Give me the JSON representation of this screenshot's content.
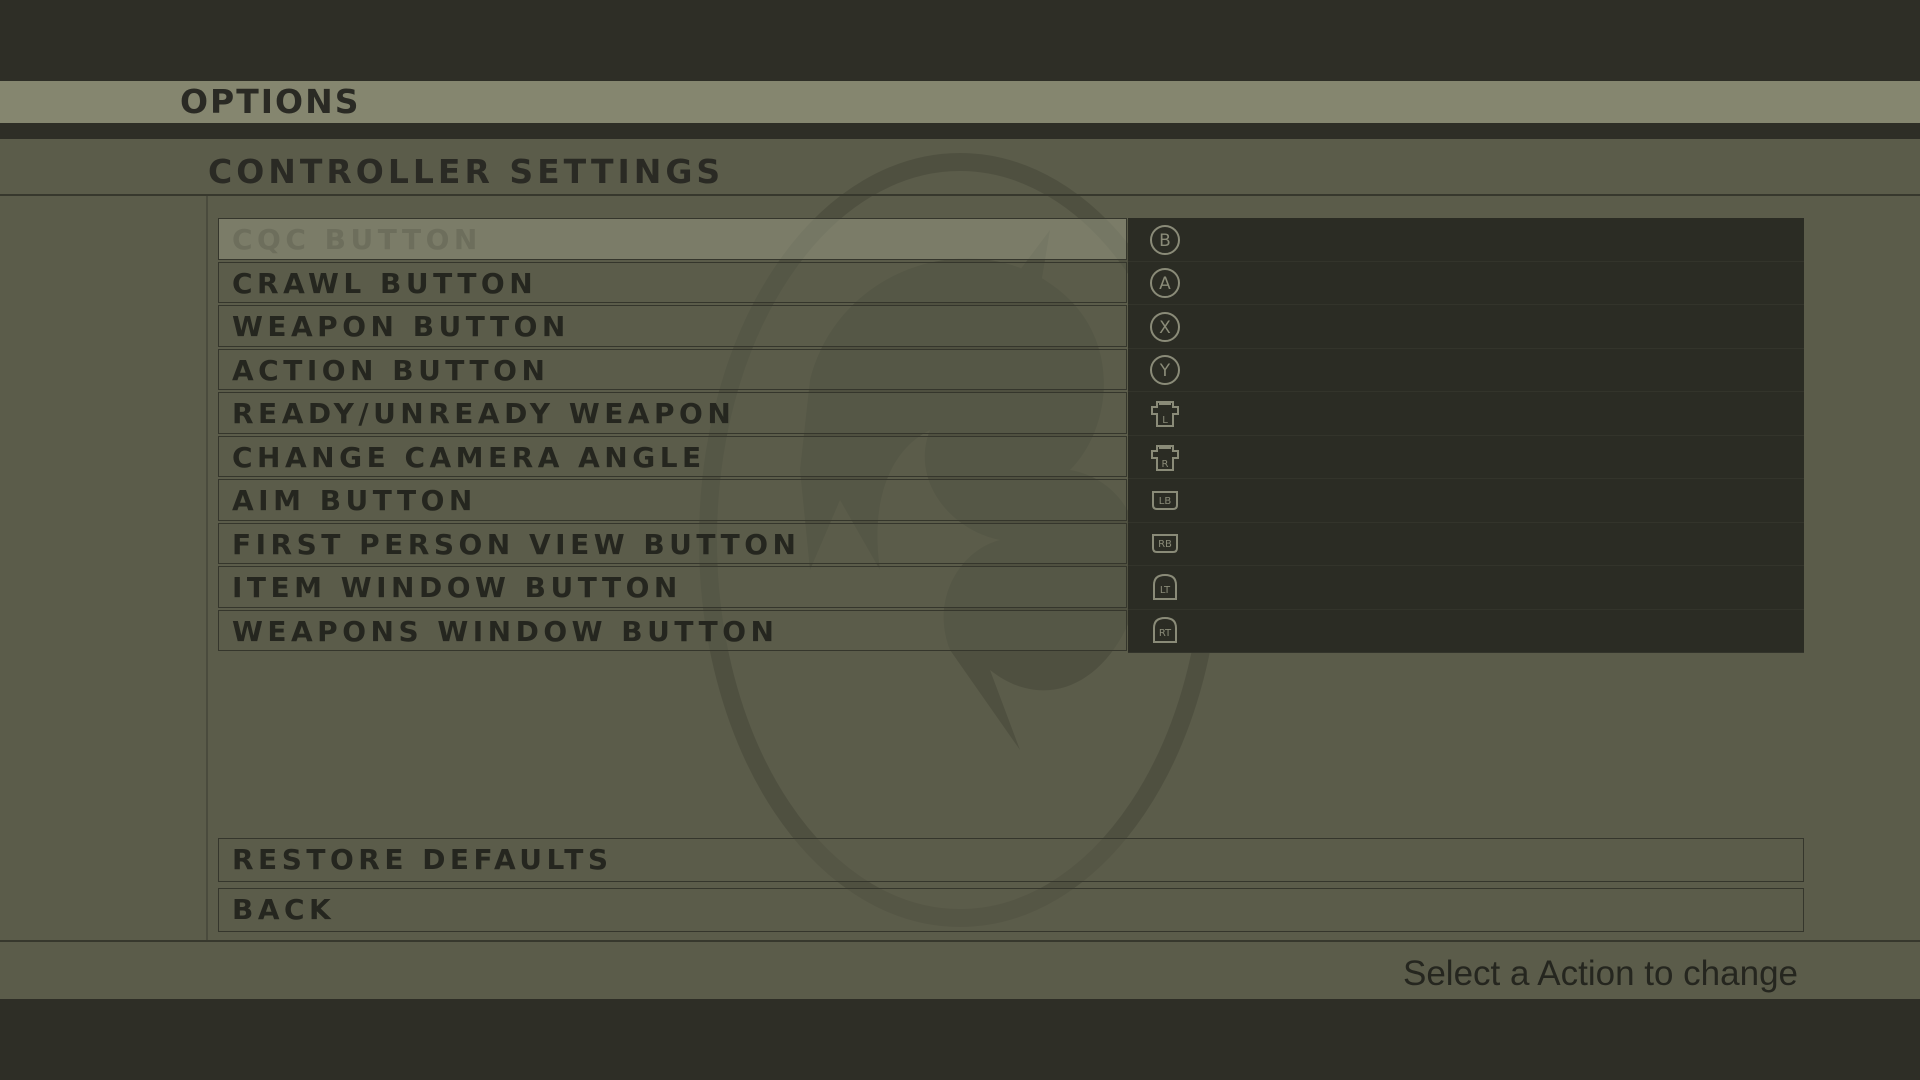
{
  "header": {
    "title": "OPTIONS"
  },
  "section": {
    "title": "CONTROLLER SETTINGS"
  },
  "bindings": [
    {
      "label": "CQC BUTTON",
      "glyph": "b-button-icon",
      "glyph_text": "B",
      "selected": true
    },
    {
      "label": "CRAWL BUTTON",
      "glyph": "a-button-icon",
      "glyph_text": "A"
    },
    {
      "label": "WEAPON BUTTON",
      "glyph": "x-button-icon",
      "glyph_text": "X"
    },
    {
      "label": "ACTION BUTTON",
      "glyph": "y-button-icon",
      "glyph_text": "Y"
    },
    {
      "label": "READY/UNREADY WEAPON",
      "glyph": "left-stick-click-icon",
      "glyph_text": "L"
    },
    {
      "label": "CHANGE CAMERA ANGLE",
      "glyph": "right-stick-click-icon",
      "glyph_text": "R"
    },
    {
      "label": "AIM BUTTON",
      "glyph": "lb-bumper-icon",
      "glyph_text": "LB"
    },
    {
      "label": "FIRST PERSON VIEW BUTTON",
      "glyph": "rb-bumper-icon",
      "glyph_text": "RB"
    },
    {
      "label": "ITEM WINDOW BUTTON",
      "glyph": "lt-trigger-icon",
      "glyph_text": "LT"
    },
    {
      "label": "WEAPONS WINDOW BUTTON",
      "glyph": "rt-trigger-icon",
      "glyph_text": "RT"
    }
  ],
  "menu": {
    "restore_label": "RESTORE DEFAULTS",
    "back_label": "BACK"
  },
  "footer": {
    "hint": "Select a Action to change"
  },
  "watermark": {
    "text": "FOX",
    "icon": "fox-logo-icon"
  },
  "colors": {
    "panel": "#5b5c4a",
    "header_bar": "#85866f",
    "binding_bg": "#2b2c24",
    "text": "#25261f"
  }
}
